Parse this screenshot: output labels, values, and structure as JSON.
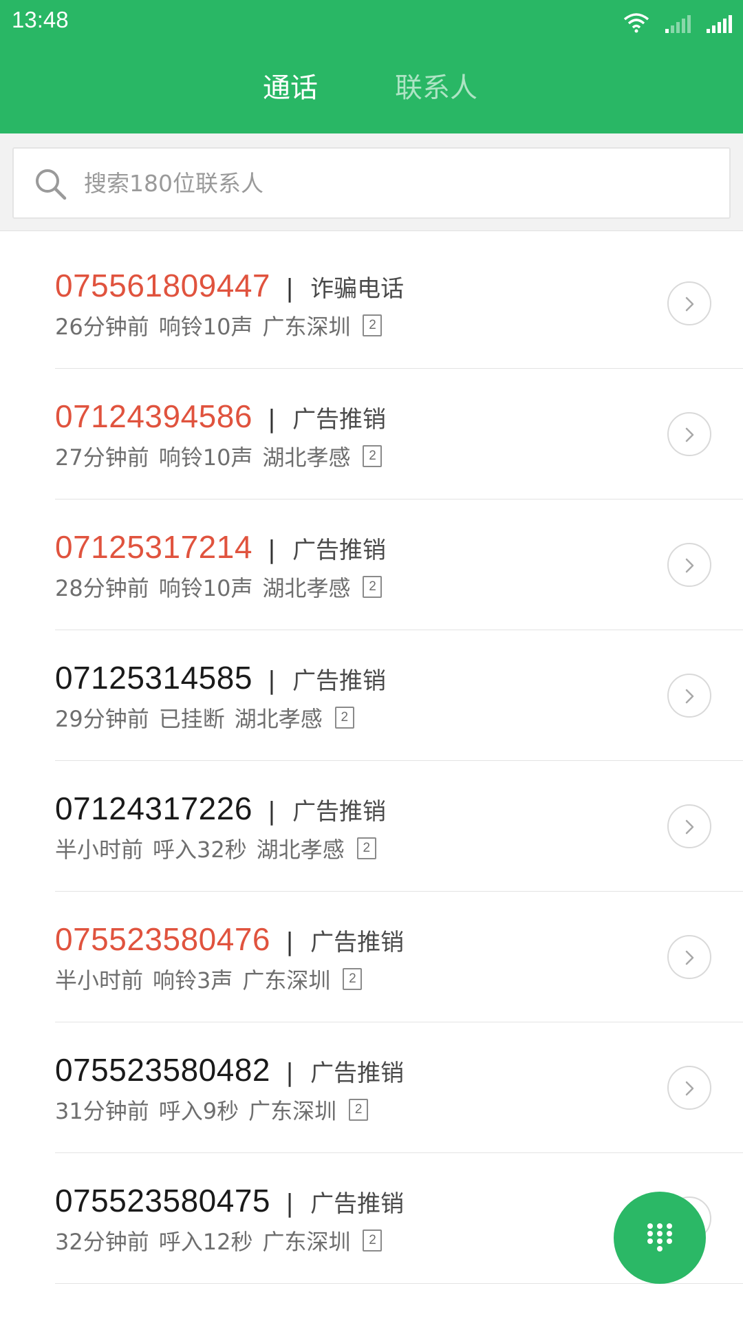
{
  "status_bar": {
    "time": "13:48",
    "icons": [
      "wifi-icon",
      "signal-weak-icon",
      "signal-full-icon"
    ]
  },
  "tabs": [
    {
      "label": "通话",
      "active": true
    },
    {
      "label": "联系人",
      "active": false
    }
  ],
  "search": {
    "placeholder": "搜索180位联系人",
    "icon": "search-icon"
  },
  "calls": [
    {
      "number": "075561809447",
      "missed": true,
      "tag": "诈骗电话",
      "time": "26分钟前",
      "status": "响铃10声",
      "location": "广东深圳",
      "sim": "2"
    },
    {
      "number": "07124394586",
      "missed": true,
      "tag": "广告推销",
      "time": "27分钟前",
      "status": "响铃10声",
      "location": "湖北孝感",
      "sim": "2"
    },
    {
      "number": "07125317214",
      "missed": true,
      "tag": "广告推销",
      "time": "28分钟前",
      "status": "响铃10声",
      "location": "湖北孝感",
      "sim": "2"
    },
    {
      "number": "07125314585",
      "missed": false,
      "tag": "广告推销",
      "time": "29分钟前",
      "status": "已挂断",
      "location": "湖北孝感",
      "sim": "2"
    },
    {
      "number": "07124317226",
      "missed": false,
      "tag": "广告推销",
      "time": "半小时前",
      "status": "呼入32秒",
      "location": "湖北孝感",
      "sim": "2"
    },
    {
      "number": "075523580476",
      "missed": true,
      "tag": "广告推销",
      "time": "半小时前",
      "status": "响铃3声",
      "location": "广东深圳",
      "sim": "2"
    },
    {
      "number": "075523580482",
      "missed": false,
      "tag": "广告推销",
      "time": "31分钟前",
      "status": "呼入9秒",
      "location": "广东深圳",
      "sim": "2"
    },
    {
      "number": "075523580475",
      "missed": false,
      "tag": "广告推销",
      "time": "32分钟前",
      "status": "呼入12秒",
      "location": "广东深圳",
      "sim": "2"
    }
  ],
  "separator": "|",
  "colors": {
    "header": "#29b765",
    "missed": "#e0533e",
    "fab": "#2bb866"
  },
  "fab": {
    "icon": "dialpad-icon"
  }
}
